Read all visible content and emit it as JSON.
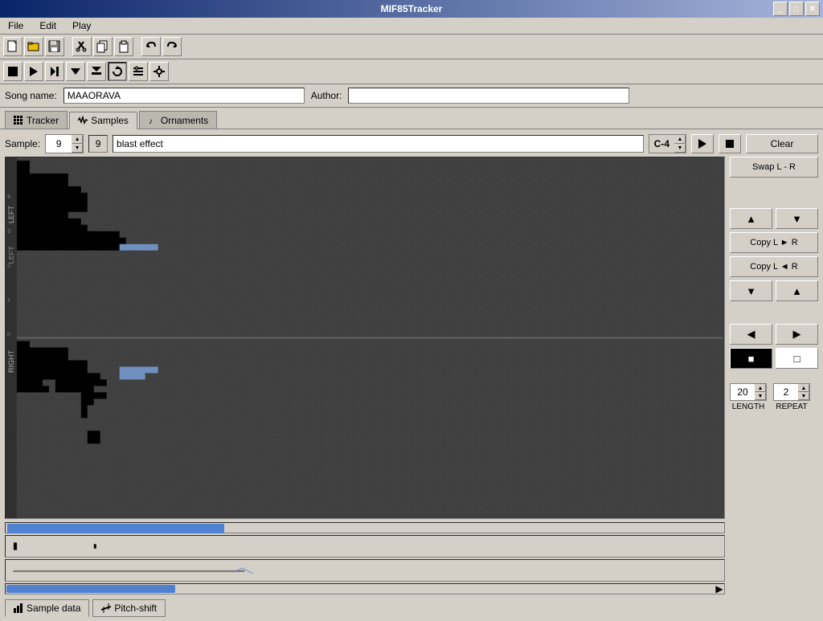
{
  "window": {
    "title": "MIF85Tracker"
  },
  "titlebar": {
    "minimize": "_",
    "maximize": "□",
    "close": "✕"
  },
  "menu": {
    "items": [
      "File",
      "Edit",
      "Play"
    ]
  },
  "toolbar1": {
    "icons": [
      "new",
      "open",
      "save",
      "cut",
      "copy",
      "paste",
      "undo",
      "redo"
    ]
  },
  "toolbar2": {
    "icons": [
      "stop",
      "play",
      "play-loop",
      "down",
      "down-fill",
      "refresh",
      "config",
      "settings"
    ]
  },
  "songbar": {
    "song_label": "Song name:",
    "song_value": "MAAORAVA",
    "author_label": "Author:",
    "author_value": ""
  },
  "tabs": {
    "items": [
      {
        "label": "Tracker",
        "icon": "grid"
      },
      {
        "label": "Samples",
        "icon": "wave",
        "active": true
      },
      {
        "label": "Ornaments",
        "icon": "music"
      }
    ]
  },
  "sample": {
    "label": "Sample:",
    "number": "9",
    "sub_number": "9",
    "name": "blast effect",
    "note": "C-4",
    "clear_label": "Clear",
    "swap_label": "Swap L - R",
    "copy_lr_label": "Copy L ► R",
    "copy_rl_label": "Copy L ◄ R",
    "length_label": "LENGTH",
    "length_value": "20",
    "repeat_label": "REPEAT",
    "repeat_value": "2"
  },
  "bottom_tabs": [
    {
      "label": "Sample data",
      "icon": "bar-chart",
      "active": true
    },
    {
      "label": "Pitch-shift",
      "icon": "pitch"
    }
  ],
  "colors": {
    "wave_bg": "#404040",
    "wave_black": "#000000",
    "wave_blue": "#7090c0",
    "wave_grid": "#555555",
    "scroll_thumb": "#5080d0",
    "accent": "#0a246a"
  }
}
